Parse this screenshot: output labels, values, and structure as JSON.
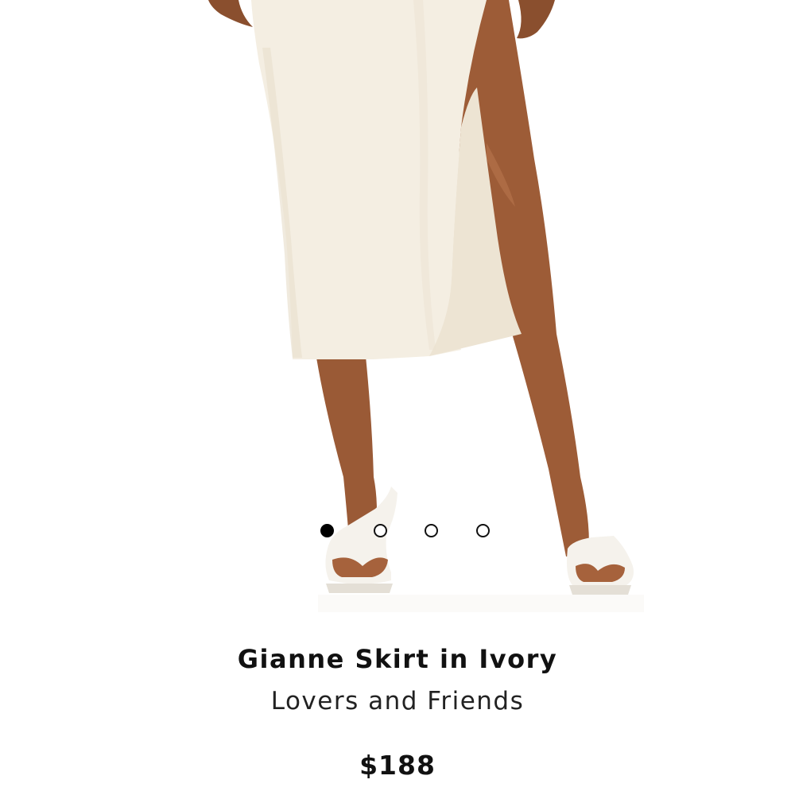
{
  "product": {
    "title": "Gianne Skirt in Ivory",
    "brand": "Lovers and Friends",
    "price": "$188",
    "image_subject": "ivory satin midi skirt with leg slit and white heeled sandals"
  },
  "carousel": {
    "total_slides": 4,
    "active_index": 0,
    "dots": [
      "slide-1",
      "slide-2",
      "slide-3",
      "slide-4"
    ]
  },
  "colors": {
    "skirt": "#f4eee2",
    "skin": "#9a5a36",
    "text": "#111111",
    "dot_active": "#000000"
  }
}
